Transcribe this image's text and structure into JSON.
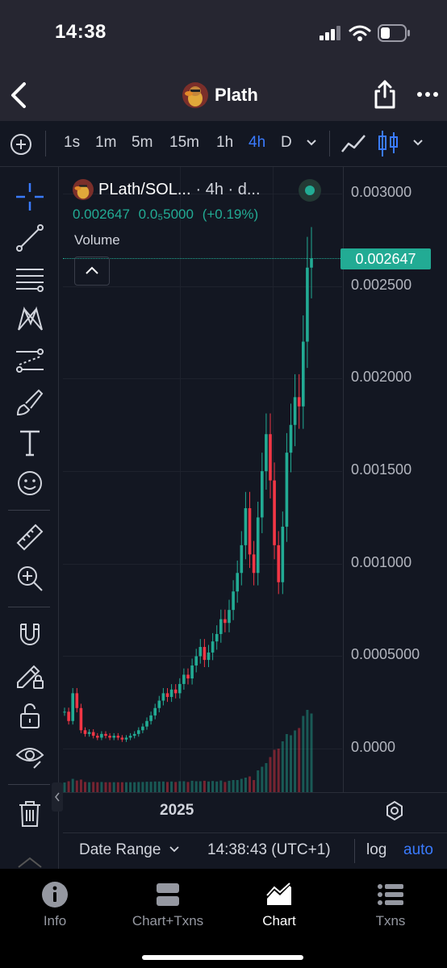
{
  "status_bar": {
    "time": "14:38"
  },
  "header": {
    "title": "Plath",
    "icons": [
      "back-chevron-icon",
      "share-icon",
      "more-icon"
    ]
  },
  "toolbar": {
    "timeframes": [
      "1s",
      "1m",
      "5m",
      "15m",
      "1h",
      "4h",
      "D"
    ],
    "active_timeframe": "4h",
    "icons": [
      "add-circle-icon",
      "chevron-down-icon",
      "line-chart-icon",
      "candles-icon",
      "chevron-down-icon"
    ]
  },
  "tools": [
    "crosshair-icon",
    "trend-line-icon",
    "horizontal-lines-icon",
    "pattern-icon",
    "projection-icon",
    "brush-icon",
    "text-icon",
    "emoji-icon",
    "ruler-icon",
    "zoom-in-icon",
    "magnet-icon",
    "lock-drawing-icon",
    "unlock-icon",
    "eye-icon",
    "trash-icon"
  ],
  "legend": {
    "pair": "PLath/SOL...",
    "pair_suffix": "· 4h · d...",
    "price": "0.002647",
    "change_abs": "0.0₅5000",
    "change_pct": "(+0.19%)",
    "volume_label": "Volume"
  },
  "price_scale": {
    "labels": [
      "0.003000",
      "0.002500",
      "0.002000",
      "0.001500",
      "0.001000",
      "0.0005000",
      "0.0000"
    ],
    "last_price": "0.002647"
  },
  "time_axis": {
    "year_label": "2025"
  },
  "bottom_bar": {
    "date_range": "Date Range",
    "clock": "14:38:43 (UTC+1)",
    "log": "log",
    "auto": "auto"
  },
  "tab_bar": {
    "tabs": [
      {
        "label": "Info",
        "icon": "info-icon"
      },
      {
        "label": "Chart+Txns",
        "icon": "chart-txns-icon"
      },
      {
        "label": "Chart",
        "icon": "area-chart-icon"
      },
      {
        "label": "Txns",
        "icon": "list-icon"
      }
    ],
    "active": "Chart"
  },
  "colors": {
    "up": "#22ab94",
    "down": "#f23645",
    "accent": "#3a7bff",
    "background": "#131722"
  },
  "chart_data": {
    "type": "candlestick",
    "title": "",
    "xlabel": "",
    "ylabel": "",
    "ylim": [
      -0.0002,
      0.0032
    ],
    "last_price": 0.002647,
    "x_tick_labels": [
      "2025"
    ],
    "close_series_approx": [
      0.0002,
      0.00015,
      0.0003,
      0.00022,
      0.0001,
      8e-05,
      9e-05,
      7e-05,
      6e-05,
      8e-05,
      7e-05,
      6e-05,
      7e-05,
      6e-05,
      5e-05,
      6e-05,
      7e-05,
      8e-05,
      0.0001,
      0.00012,
      0.00015,
      0.00018,
      0.00022,
      0.00026,
      0.0003,
      0.00028,
      0.00032,
      0.0003,
      0.00035,
      0.0004,
      0.00038,
      0.00045,
      0.0005,
      0.00055,
      0.00048,
      0.00052,
      0.00058,
      0.00062,
      0.0007,
      0.00068,
      0.00075,
      0.00085,
      0.00095,
      0.0011,
      0.0013,
      0.00105,
      0.00095,
      0.00125,
      0.0015,
      0.0017,
      0.00145,
      0.0011,
      0.0009,
      0.0012,
      0.0016,
      0.00175,
      0.0019,
      0.00185,
      0.0022,
      0.0026,
      0.00265
    ]
  }
}
